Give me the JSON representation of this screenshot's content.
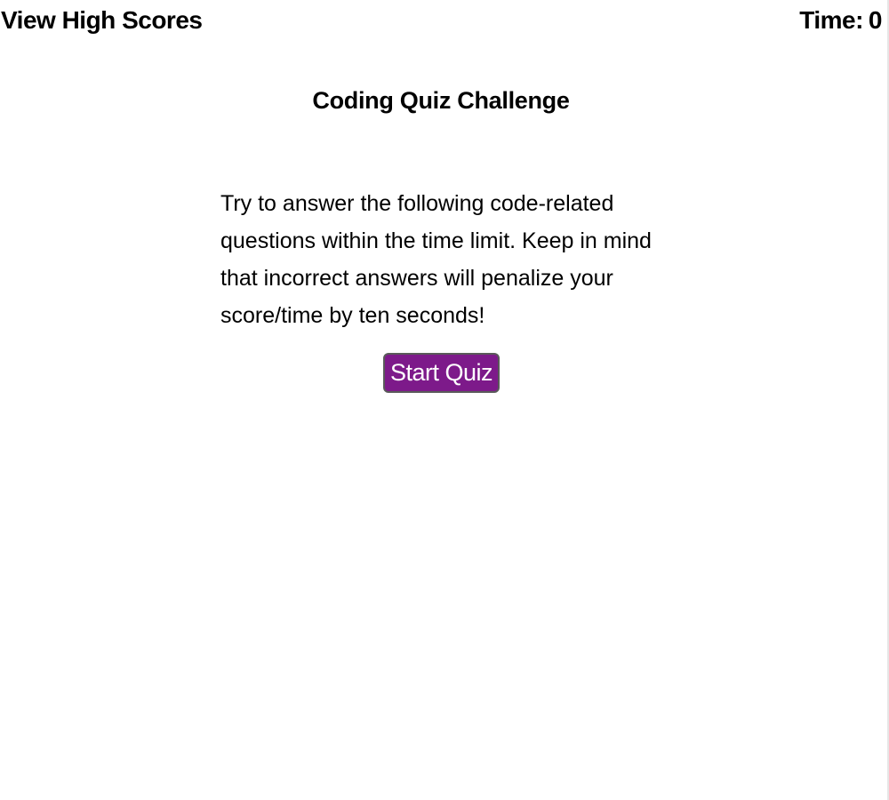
{
  "header": {
    "high_scores_link": "View High Scores",
    "timer_label": "Time:",
    "timer_value": "0"
  },
  "main": {
    "title": "Coding Quiz Challenge",
    "instructions": "Try to answer the following code-related questions within the time limit. Keep in mind that incorrect answers will penalize your score/time by ten seconds!",
    "start_button_label": "Start Quiz"
  },
  "colors": {
    "start_button_background": "#7d1a8a",
    "start_button_text": "#ffffff",
    "page_background": "#ffffff",
    "text": "#000000"
  }
}
